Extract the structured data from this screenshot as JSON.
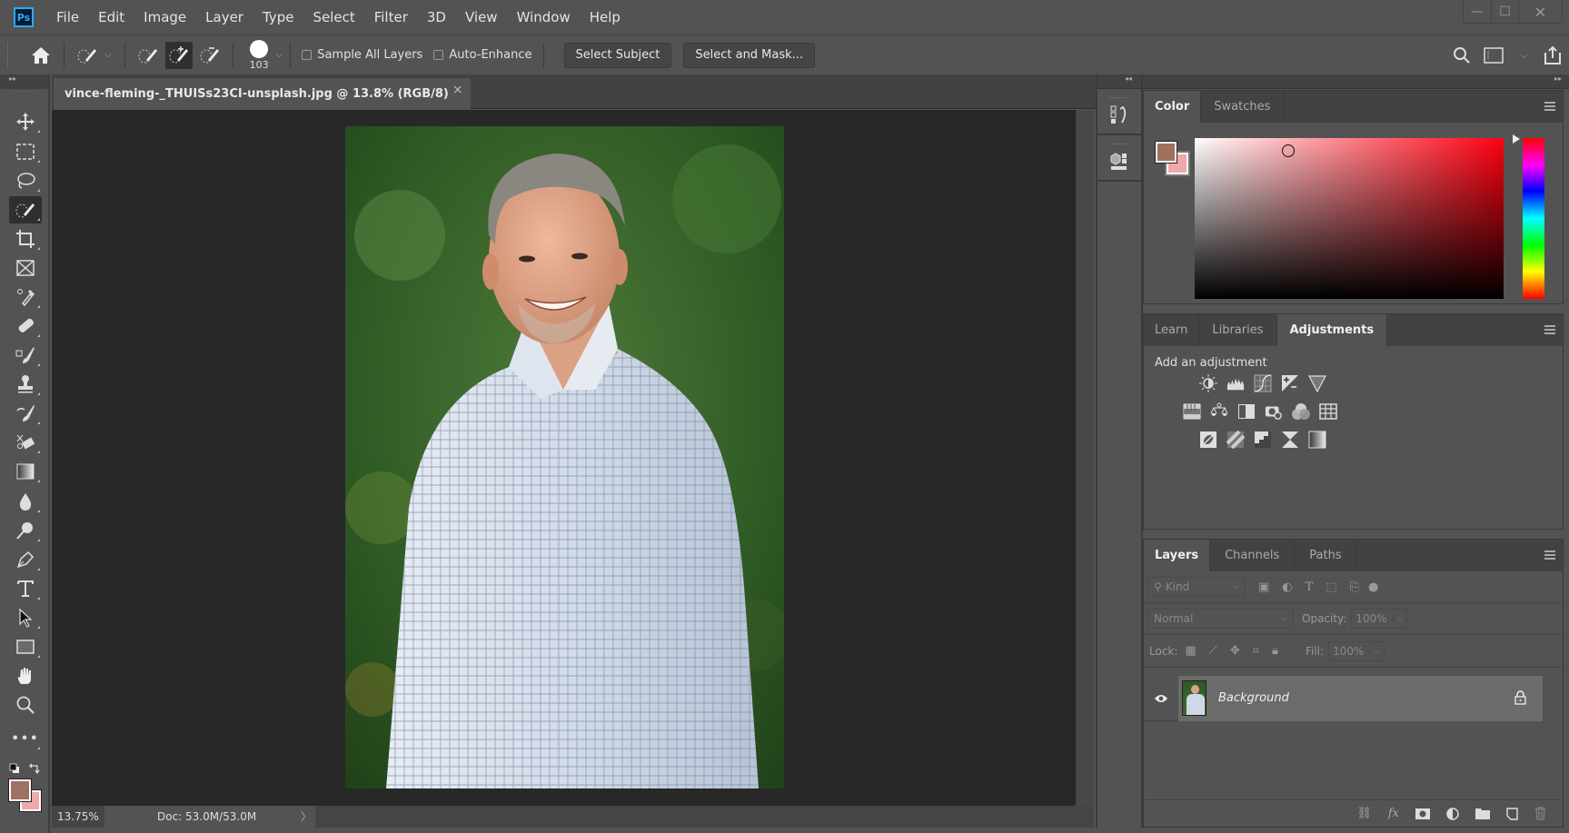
{
  "app": {
    "logo": "Ps",
    "menu": [
      "File",
      "Edit",
      "Image",
      "Layer",
      "Type",
      "Select",
      "Filter",
      "3D",
      "View",
      "Window",
      "Help"
    ],
    "window_controls": {
      "minimize": "—",
      "maximize": "☐",
      "close": "✕"
    }
  },
  "options_bar": {
    "brush_size": "103",
    "sample_all_layers": {
      "label": "Sample All Layers",
      "checked": false
    },
    "auto_enhance": {
      "label": "Auto-Enhance",
      "checked": false
    },
    "select_subject": "Select Subject",
    "select_and_mask": "Select and Mask..."
  },
  "document": {
    "tab_title": "vince-fleming-_THUISs23CI-unsplash.jpg @ 13.8% (RGB/8)",
    "close": "×",
    "zoom": "13.75%",
    "doc_info": "Doc: 53.0M/53.0M",
    "status_arrow": "〉"
  },
  "colors": {
    "foreground": "#a07060",
    "background": "#f0a8ac",
    "hue": "#ff0010"
  },
  "color_panel": {
    "tabs": [
      {
        "label": "Color",
        "active": true
      },
      {
        "label": "Swatches",
        "active": false
      }
    ]
  },
  "adjustments_panel": {
    "tabs": [
      {
        "label": "Learn",
        "active": false
      },
      {
        "label": "Libraries",
        "active": false
      },
      {
        "label": "Adjustments",
        "active": true
      }
    ],
    "label": "Add an adjustment",
    "rows": [
      [
        "brightness-contrast",
        "levels",
        "curves",
        "exposure",
        "vibrance"
      ],
      [
        "hue-saturation",
        "color-balance",
        "black-white",
        "photo-filter",
        "channel-mixer",
        "color-lookup"
      ],
      [
        "invert",
        "posterize",
        "threshold",
        "selective-color",
        "gradient-map"
      ]
    ]
  },
  "layers_panel": {
    "tabs": [
      {
        "label": "Layers",
        "active": true
      },
      {
        "label": "Channels",
        "active": false
      },
      {
        "label": "Paths",
        "active": false
      }
    ],
    "filter_kind": "Kind",
    "blend_mode": "Normal",
    "opacity_label": "Opacity:",
    "opacity": "100%",
    "lock_label": "Lock:",
    "fill_label": "Fill:",
    "fill": "100%",
    "layers": [
      {
        "name": "Background",
        "visible": true,
        "locked": true
      }
    ]
  }
}
